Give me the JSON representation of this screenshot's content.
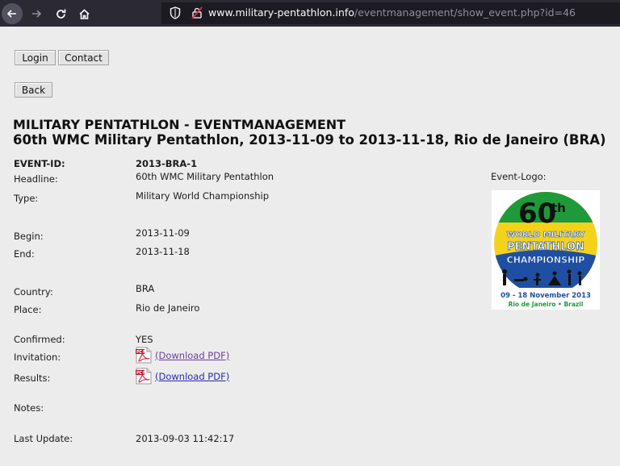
{
  "browser": {
    "url_host": "www.military-pentathlon.info",
    "url_path": "/eventmanagement/show_event.php?id=46"
  },
  "buttons": {
    "login": "Login",
    "contact": "Contact",
    "back": "Back"
  },
  "heading": {
    "line1": "MILITARY PENTATHLON - EVENTMANAGEMENT",
    "line2": "60th WMC Military Pentathlon, 2013-11-09 to 2013-11-18, Rio de Janeiro (BRA)"
  },
  "event": {
    "id_label": "EVENT-ID:",
    "id_value": "2013-BRA-1",
    "headline_label": "Headline:",
    "headline_value": "60th WMC Military Pentathlon",
    "type_label": "Type:",
    "type_value": "Military World Championship",
    "begin_label": "Begin:",
    "begin_value": "2013-11-09",
    "end_label": "End:",
    "end_value": "2013-11-18",
    "country_label": "Country:",
    "country_value": "BRA",
    "place_label": "Place:",
    "place_value": "Rio de Janeiro",
    "confirmed_label": "Confirmed:",
    "confirmed_value": "YES",
    "invitation_label": "Invitation:",
    "invitation_link": "(Download PDF)",
    "results_label": "Results:",
    "results_link": "(Download PDF)",
    "notes_label": "Notes:",
    "notes_value": "",
    "last_update_label": "Last Update:",
    "last_update_value": "2013-09-03 11:42:17",
    "logo_label": "Event-Logo:"
  },
  "logo": {
    "big": "60",
    "sup": "th",
    "line1": "WORLD MILITARY",
    "line2": "PENTATHLON",
    "line3": "CHAMPIONSHIP",
    "dates": "09 - 18 November 2013",
    "place": "Rio de Janeiro • Brazil"
  },
  "colors": {
    "logo_green": "#1f9a3a",
    "logo_yellow": "#f4d21c",
    "logo_blue": "#1f4fa3",
    "link": "#2a2ab0"
  }
}
